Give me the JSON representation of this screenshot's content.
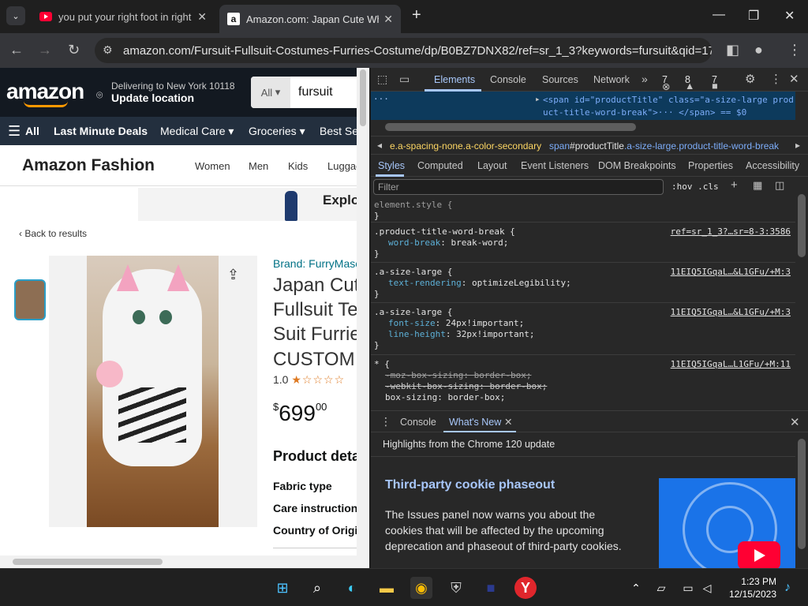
{
  "browser": {
    "tabs": [
      {
        "title": "you put your right foot in right",
        "favicon": "youtube-icon",
        "active": false
      },
      {
        "title": "Amazon.com: Japan Cute White",
        "favicon": "amazon-icon",
        "active": true
      }
    ],
    "url": "amazon.com/Fursuit-Fullsuit-Costumes-Furries-Costume/dp/B0BZ7DNX82/ref=sr_1_3?keywords=fursuit&qid=17..."
  },
  "amazon": {
    "deliver_line1": "Delivering to New York 10118",
    "deliver_line2": "Update location",
    "search_category": "All",
    "search_value": "fursuit",
    "nav": {
      "all": "All",
      "items": [
        "Last Minute Deals",
        "Medical Care ▾",
        "Groceries ▾",
        "Best Se"
      ]
    },
    "fashion": {
      "title": "Amazon Fashion",
      "items": [
        "Women",
        "Men",
        "Kids",
        "Luggag"
      ]
    },
    "banner_text": "Explo",
    "back": "‹ Back to results",
    "brand": "Brand: FurryMasc",
    "title_lines": [
      "Japan Cut",
      "Fullsuit Te",
      "Suit Furrie",
      "CUSTOM"
    ],
    "rating": "1.0",
    "stars": "★☆☆☆☆",
    "price_symbol": "$",
    "price_whole": "699",
    "price_cents": "00",
    "product_details": "Product deta",
    "specs": [
      "Fabric type",
      "Care instruction",
      "Country of Origi"
    ]
  },
  "devtools": {
    "tabs": [
      "Elements",
      "Console",
      "Sources",
      "Network",
      "»"
    ],
    "errors": "7",
    "warnings": "8",
    "issues": "7",
    "dom_line1": "<span id=\"productTitle\" class=\"a-size-large prod",
    "dom_line2": "uct-title-word-break\">··· </span> == $0",
    "dom_ellipsis": "···",
    "crumbs": [
      "e.a-spacing-none.a-color-secondary",
      "span",
      "#productTitle",
      ".a-size-large.product-title-word-break"
    ],
    "subtabs": [
      "Styles",
      "Computed",
      "Layout",
      "Event Listeners",
      "DOM Breakpoints",
      "Properties",
      "Accessibility"
    ],
    "filter_placeholder": "Filter",
    "hov": ":hov  .cls",
    "rules": [
      {
        "selector": "element.style {",
        "source": "",
        "lines": [],
        "close": "}"
      },
      {
        "selector": ".product-title-word-break {",
        "source": "ref=sr_1_3?…sr=8-3:3586",
        "lines": [
          {
            "prop": "word-break",
            "val": "break-word;"
          }
        ],
        "close": "}"
      },
      {
        "selector": ".a-size-large {",
        "source": "11EIQ5IGqaL…&L1GFu/+M:3",
        "lines": [
          {
            "prop": "text-rendering",
            "val": "optimizeLegibility;"
          }
        ],
        "close": "}"
      },
      {
        "selector": ".a-size-large {",
        "source": "11EIQ5IGqaL…&L1GFu/+M:3",
        "lines": [
          {
            "prop": "font-size",
            "val": "24px!important;"
          },
          {
            "prop": "line-height",
            "val": "32px!important;"
          }
        ],
        "close": "}"
      },
      {
        "selector": "* {",
        "source": "11EIQ5IGqaL…L1GFu/+M:11",
        "lines": [
          {
            "prop": "-moz-box-sizing",
            "val": "border-box;",
            "struck": true
          },
          {
            "prop": "-webkit-box-sizing",
            "val": "border-box;",
            "struck": true
          },
          {
            "prop": "box-sizing",
            "val": "border-box;"
          }
        ],
        "close": "}"
      }
    ],
    "drawer_tabs": [
      "Console",
      "What's New"
    ],
    "whatsnew": {
      "highlight": "Highlights from the Chrome 120 update",
      "heading": "Third-party cookie phaseout",
      "body": [
        "The Issues panel now warns you about the",
        "cookies that will be affected by the upcoming",
        "deprecation and phaseout of third-party cookies."
      ]
    }
  },
  "taskbar": {
    "time": "1:23 PM",
    "date": "12/15/2023"
  }
}
